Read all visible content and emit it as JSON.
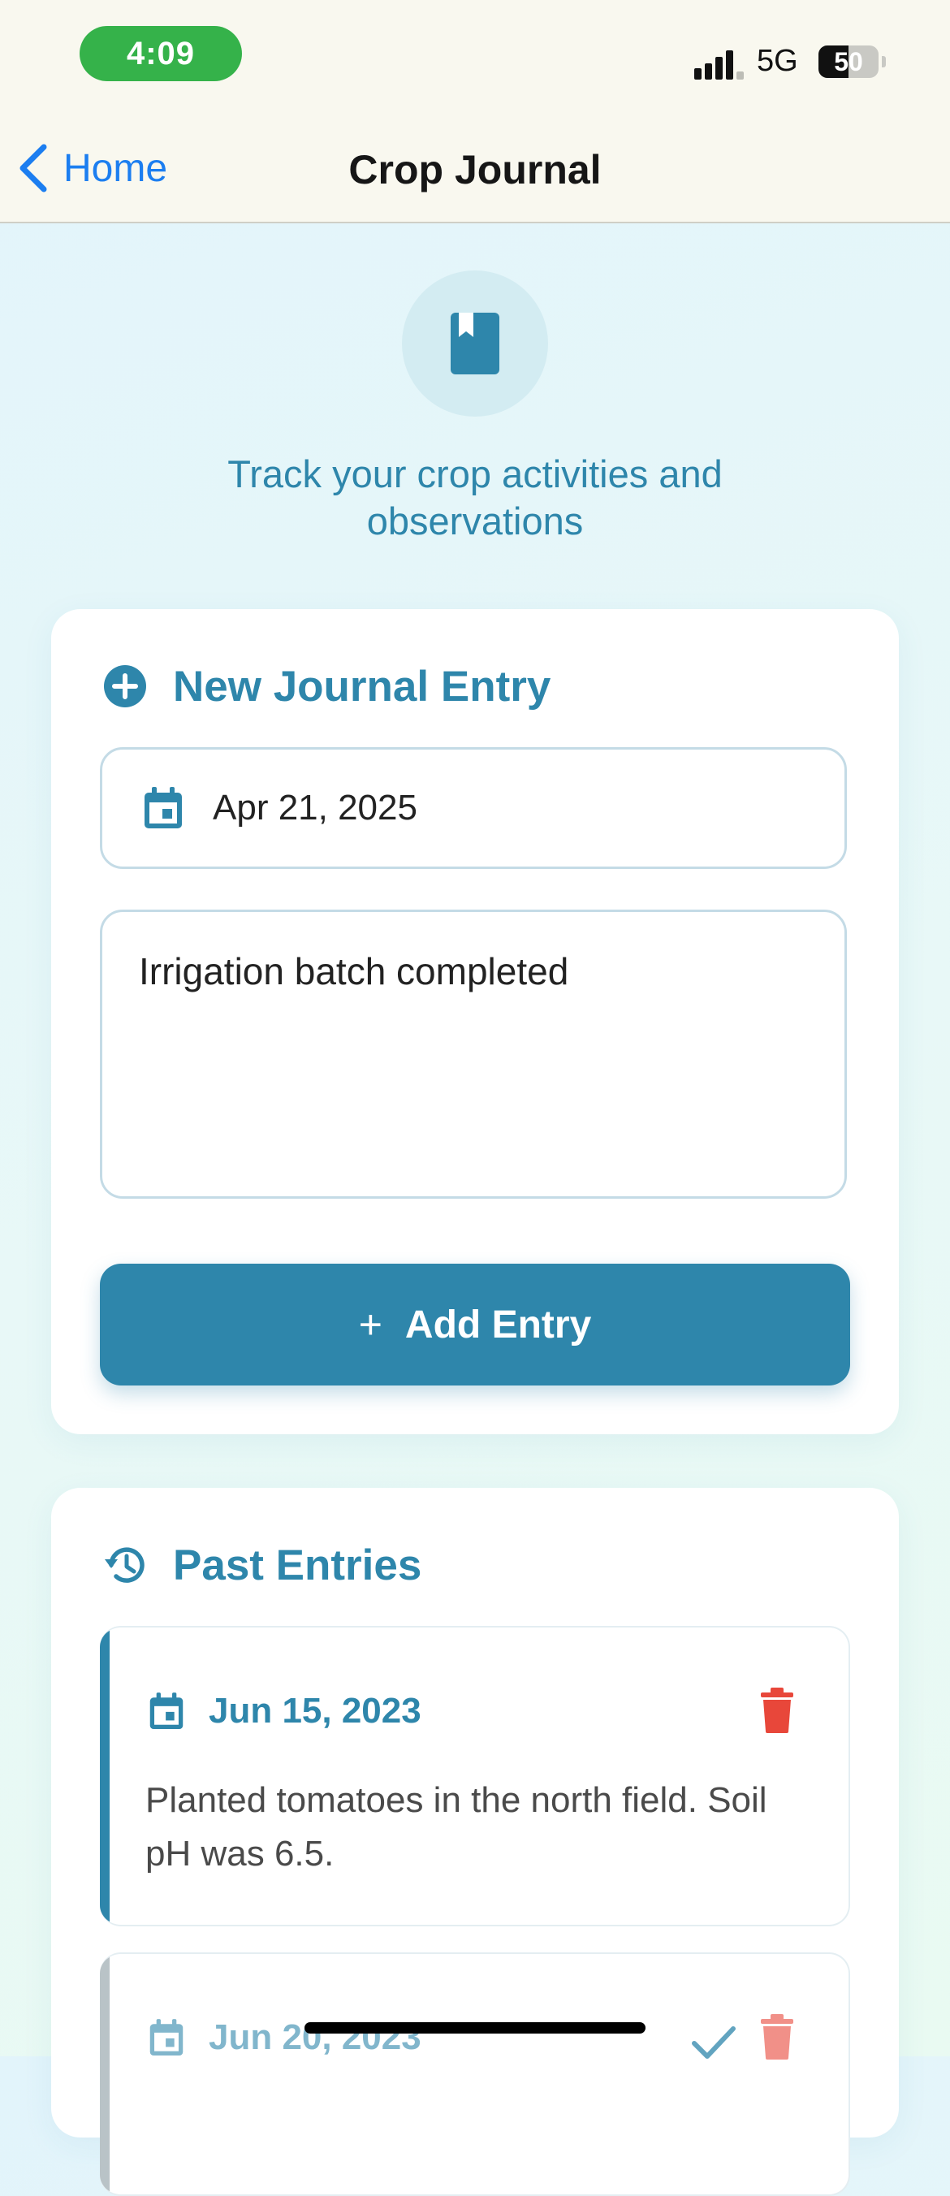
{
  "status_bar": {
    "time": "4:09",
    "network": "5G",
    "battery": "50",
    "battery_level": 0.5
  },
  "nav": {
    "back_label": "Home",
    "title": "Crop Journal"
  },
  "hero": {
    "icon": "book-icon",
    "subtitle": "Track your crop activities and observations"
  },
  "new_entry": {
    "title": "New Journal Entry",
    "header_icon": "plus-circle-icon",
    "date_icon": "calendar-icon",
    "date_value": "Apr 21, 2025",
    "note_value": "Irrigation batch completed",
    "add_button_icon": "+",
    "add_button_label": "Add Entry"
  },
  "past_entries": {
    "title": "Past Entries",
    "header_icon": "history-icon",
    "entries": [
      {
        "date": "Jun 15, 2023",
        "text": "Planted tomatoes in the north field. Soil pH was 6.5.",
        "completed": false
      },
      {
        "date": "Jun 20, 2023",
        "text": "",
        "completed": true
      }
    ]
  },
  "colors": {
    "accent": "#2e86ab",
    "danger": "#e8473a",
    "link": "#1c7ef0",
    "time_pill": "#35b24a",
    "muted_border": "#b9c3c7"
  }
}
